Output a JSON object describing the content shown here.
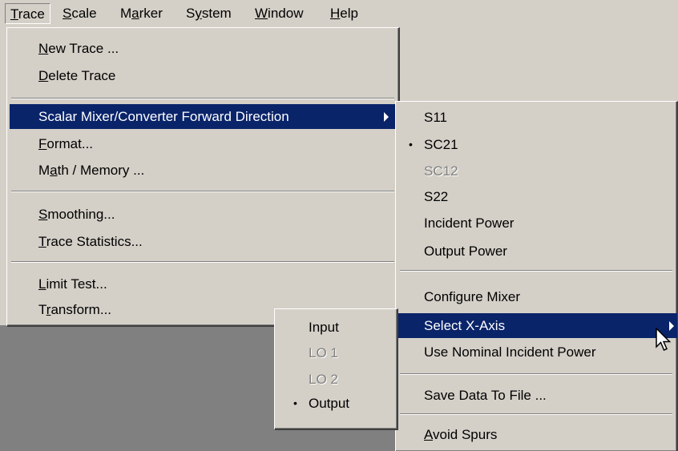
{
  "menubar": {
    "items": [
      {
        "pre": "",
        "key": "T",
        "post": "race"
      },
      {
        "pre": "",
        "key": "S",
        "post": "cale"
      },
      {
        "pre": "M",
        "key": "a",
        "post": "rker"
      },
      {
        "pre": "S",
        "key": "y",
        "post": "stem"
      },
      {
        "pre": "",
        "key": "W",
        "post": "indow"
      },
      {
        "pre": "",
        "key": "H",
        "post": "elp"
      }
    ]
  },
  "trace_menu": {
    "new_trace": {
      "pre": "",
      "key": "N",
      "post": "ew Trace ..."
    },
    "delete_trace": {
      "pre": "",
      "key": "D",
      "post": "elete Trace"
    },
    "scalar_mixer": {
      "pre": "Scalar Mixer/Converter Forward Direction",
      "key": "",
      "post": ""
    },
    "format": {
      "pre": "",
      "key": "F",
      "post": "ormat..."
    },
    "math_memory": {
      "pre": "M",
      "key": "a",
      "post": "th / Memory ..."
    },
    "smoothing": {
      "pre": "",
      "key": "S",
      "post": "moothing..."
    },
    "trace_statistics": {
      "pre": "",
      "key": "T",
      "post": "race Statistics..."
    },
    "limit_test": {
      "pre": "",
      "key": "L",
      "post": "imit Test..."
    },
    "transform": {
      "pre": "T",
      "key": "r",
      "post": "ansform..."
    }
  },
  "param_menu": {
    "s11": "S11",
    "sc21": "SC21",
    "sc12": "SC12",
    "s22": "S22",
    "incident_power": "Incident Power",
    "output_power": "Output Power",
    "configure_mixer": "Configure Mixer",
    "select_x_axis": "Select X-Axis",
    "use_nominal": "Use Nominal Incident Power",
    "save_data": "Save Data To File ...",
    "avoid_spurs": {
      "pre": "",
      "key": "A",
      "post": "void Spurs"
    }
  },
  "xaxis_menu": {
    "input": "Input",
    "lo1": "LO 1",
    "lo2": "LO 2",
    "output": "Output"
  },
  "bullet_char": "•",
  "colors": {
    "menu_bg": "#d4d0c8",
    "highlight": "#0a246a",
    "workspace": "#808080",
    "disabled": "#808080"
  }
}
